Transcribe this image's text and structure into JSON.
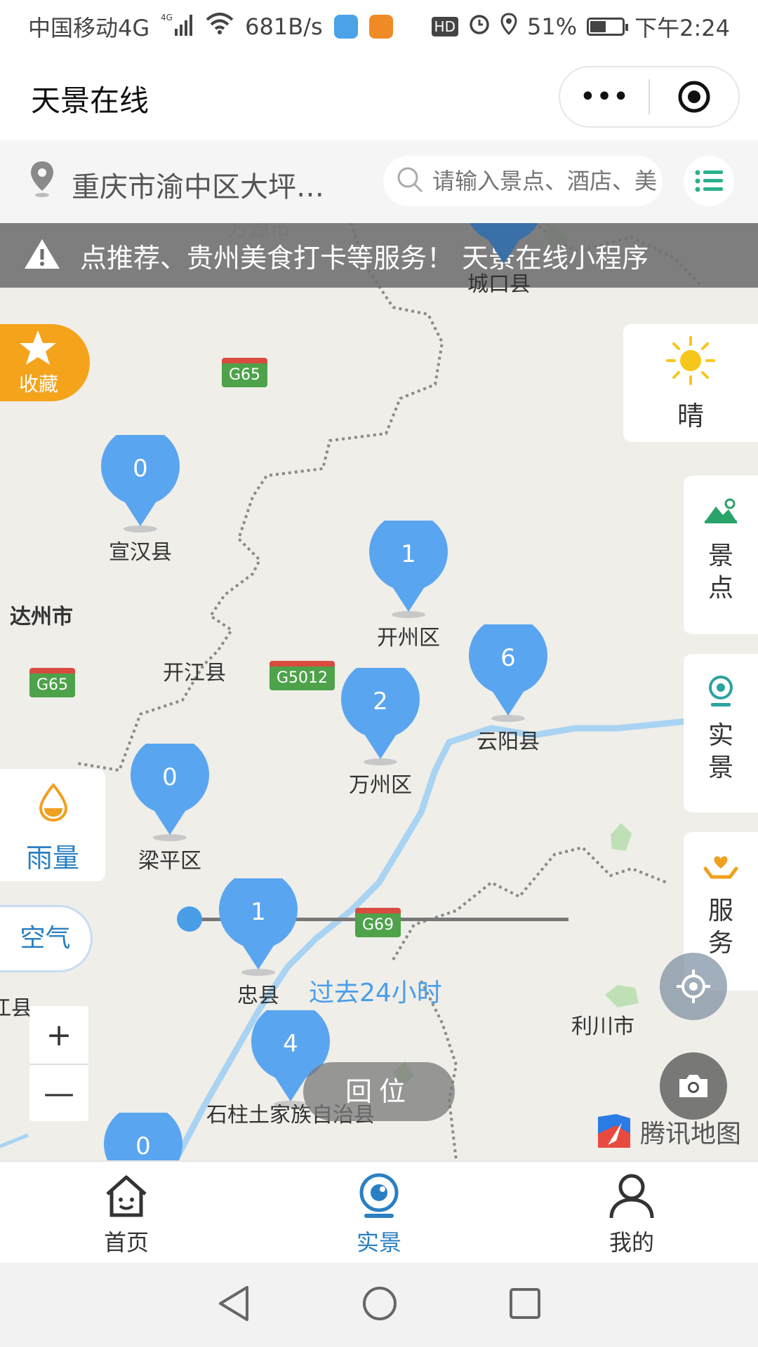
{
  "status": {
    "carrier": "中国移动4G",
    "net_tag": "4G",
    "speed": "681B/s",
    "hd": "HD",
    "battery_pct": "51%",
    "battery_level": 0.51,
    "time": "下午2:24"
  },
  "titlebar": {
    "title": "天景在线",
    "more_glyph": "•••",
    "close_glyph": "◉"
  },
  "search": {
    "location": "重庆市渝中区大坪…",
    "placeholder": "请输入景点、酒店、美食"
  },
  "notice": {
    "text": "点推荐、贵州美食打卡等服务！    天景在线小程序"
  },
  "map": {
    "places": {
      "chengkou": "城口县",
      "dazhou": "达州市",
      "kaijiang": "开江县",
      "lichuan": "利川市",
      "left_edge": "江县",
      "top_cut": "万源市"
    },
    "roads": {
      "g65a": "G65",
      "g65b": "G65",
      "g5012": "G5012",
      "g69": "G69"
    },
    "markers": [
      {
        "count": "0",
        "name": "宣汉县"
      },
      {
        "count": "1",
        "name": "开州区"
      },
      {
        "count": "6",
        "name": "云阳县"
      },
      {
        "count": "2",
        "name": "万州区"
      },
      {
        "count": "0",
        "name": "梁平区"
      },
      {
        "count": "1",
        "name": "忠县"
      },
      {
        "count": "4",
        "name": "石柱土家族自治县"
      },
      {
        "count": "0",
        "name": ""
      }
    ],
    "time_label": "过去24小时",
    "reset_label": "回位",
    "tencent_map": "腾讯地图",
    "zoom_in": "+",
    "zoom_out": "—"
  },
  "panels": {
    "favorite": "收藏",
    "weather": "晴",
    "scenic": "景点",
    "live": "实景",
    "service": "服务",
    "rain": "雨量",
    "air": "空气"
  },
  "tabs": [
    {
      "label": "首页",
      "icon": "home-icon"
    },
    {
      "label": "实景",
      "icon": "camera-live-icon",
      "active": true
    },
    {
      "label": "我的",
      "icon": "user-icon"
    }
  ],
  "colors": {
    "accent": "#2a7fc2",
    "marker": "#5aa5ef",
    "favorite": "#f4a31b",
    "road_shield": "#4ea24a"
  }
}
